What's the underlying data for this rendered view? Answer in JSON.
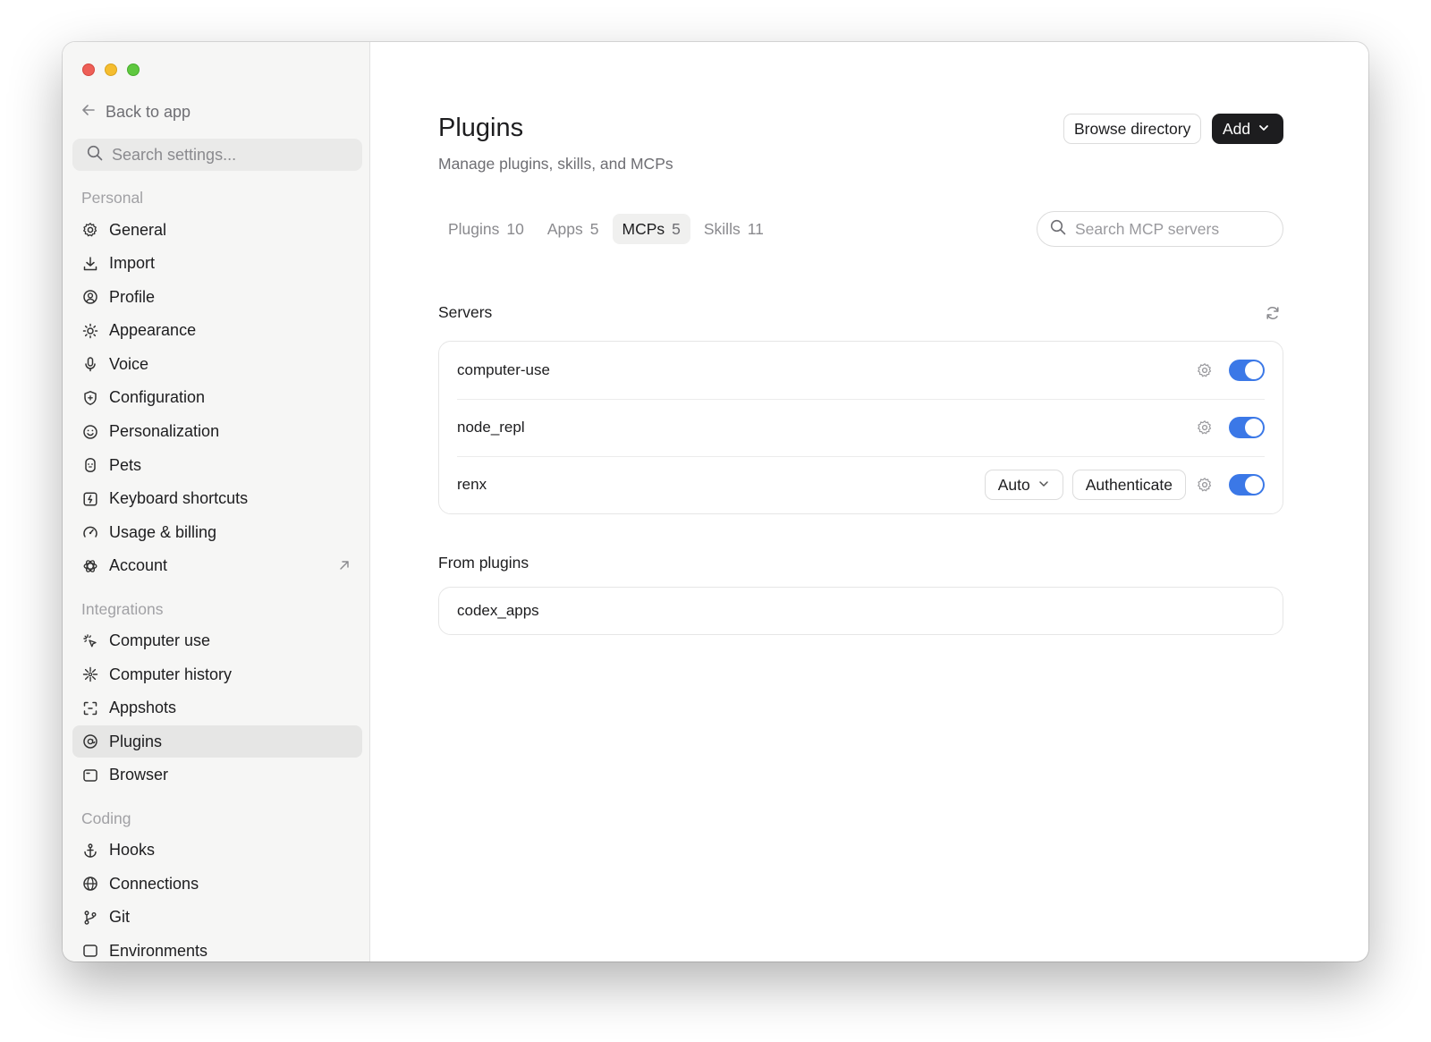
{
  "sidebar": {
    "back_label": "Back to app",
    "search_placeholder": "Search settings...",
    "sections": {
      "personal": "Personal",
      "integrations": "Integrations",
      "coding": "Coding"
    },
    "personal_items": [
      {
        "label": "General",
        "icon": "gear-icon"
      },
      {
        "label": "Import",
        "icon": "download-icon"
      },
      {
        "label": "Profile",
        "icon": "user-circle-icon"
      },
      {
        "label": "Appearance",
        "icon": "sun-icon"
      },
      {
        "label": "Voice",
        "icon": "microphone-icon"
      },
      {
        "label": "Configuration",
        "icon": "shield-icon"
      },
      {
        "label": "Personalization",
        "icon": "smiley-icon"
      },
      {
        "label": "Pets",
        "icon": "pet-icon"
      },
      {
        "label": "Keyboard shortcuts",
        "icon": "keyboard-icon"
      },
      {
        "label": "Usage & billing",
        "icon": "gauge-icon"
      },
      {
        "label": "Account",
        "icon": "openai-icon",
        "external": "external-link-icon"
      }
    ],
    "integration_items": [
      {
        "label": "Computer use",
        "icon": "cursor-click-icon"
      },
      {
        "label": "Computer history",
        "icon": "sparkle-icon"
      },
      {
        "label": "Appshots",
        "icon": "screenshot-icon"
      },
      {
        "label": "Plugins",
        "icon": "at-icon",
        "active": true
      },
      {
        "label": "Browser",
        "icon": "browser-icon"
      }
    ],
    "coding_items": [
      {
        "label": "Hooks",
        "icon": "anchor-icon"
      },
      {
        "label": "Connections",
        "icon": "globe-icon"
      },
      {
        "label": "Git",
        "icon": "git-branch-icon"
      },
      {
        "label": "Environments",
        "icon": "environment-icon"
      }
    ]
  },
  "header": {
    "title": "Plugins",
    "subtitle": "Manage plugins, skills, and MCPs",
    "browse_label": "Browse directory",
    "add_label": "Add"
  },
  "tabs": [
    {
      "label": "Plugins",
      "count": "10"
    },
    {
      "label": "Apps",
      "count": "5"
    },
    {
      "label": "MCPs",
      "count": "5",
      "active": true
    },
    {
      "label": "Skills",
      "count": "11"
    }
  ],
  "search": {
    "placeholder": "Search MCP servers"
  },
  "servers": {
    "heading": "Servers",
    "items": [
      {
        "name": "computer-use",
        "enabled": true
      },
      {
        "name": "node_repl",
        "enabled": true
      },
      {
        "name": "renx",
        "enabled": true,
        "mode": "Auto",
        "action": "Authenticate"
      }
    ]
  },
  "from_plugins": {
    "heading": "From plugins",
    "items": [
      {
        "name": "codex_apps"
      }
    ]
  },
  "colors": {
    "accent": "#3b78e7",
    "primary_button": "#1d1d1f"
  }
}
